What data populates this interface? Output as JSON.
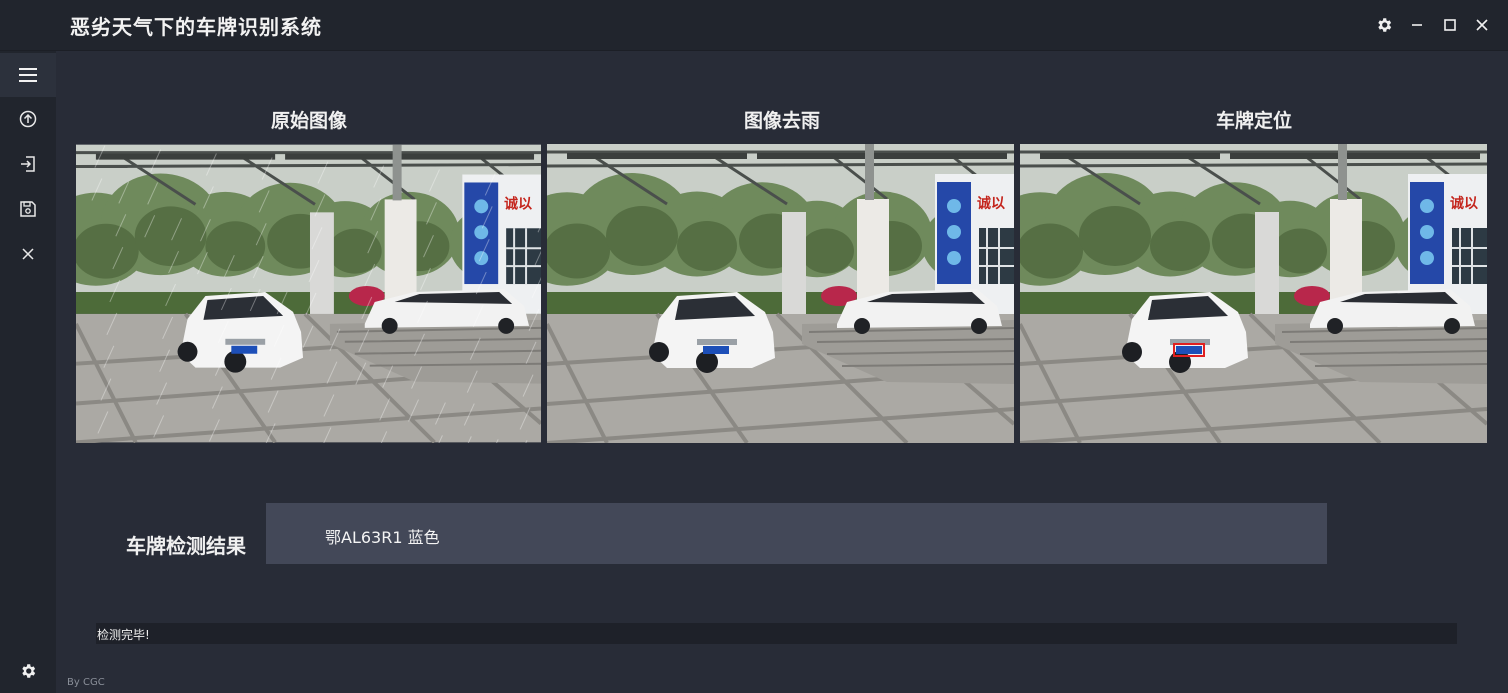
{
  "app": {
    "title": "恶劣天气下的车牌识别系统",
    "credit": "By CGC"
  },
  "window_controls": {
    "settings_icon": "gear-icon",
    "minimize_icon": "minimize-icon",
    "maximize_icon": "maximize-icon",
    "close_icon": "close-icon"
  },
  "sidebar": {
    "items": [
      {
        "icon": "menu-icon",
        "active": true
      },
      {
        "icon": "upload-icon"
      },
      {
        "icon": "import-icon"
      },
      {
        "icon": "save-icon"
      },
      {
        "icon": "close-icon"
      }
    ],
    "bottom_icon": "gear-icon"
  },
  "panels": [
    {
      "title": "原始图像",
      "rain": true,
      "plate_box": false
    },
    {
      "title": "图像去雨",
      "rain": false,
      "plate_box": false
    },
    {
      "title": "车牌定位",
      "rain": false,
      "plate_box": true
    }
  ],
  "scene": {
    "banner_text": "诚以"
  },
  "result": {
    "label": "车牌检测结果",
    "value": "鄂AL63R1 蓝色"
  },
  "status": {
    "text": "检测完毕!"
  },
  "colors": {
    "plate_blue": "#1d4fb8",
    "plate_box_red": "#e02020",
    "accent": "#434858"
  }
}
